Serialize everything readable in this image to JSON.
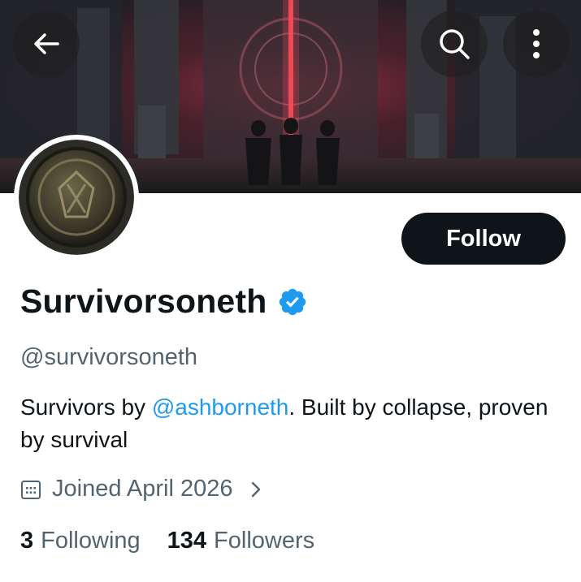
{
  "header": {
    "back_icon": "arrow-left-icon",
    "search_icon": "search-icon",
    "more_icon": "more-vertical-icon"
  },
  "banner": {
    "description_icon": "banner-image"
  },
  "profile": {
    "avatar_icon": "avatar-image",
    "follow_label": "Follow",
    "display_name": "Survivorsoneth",
    "verified_icon": "verified-badge-icon",
    "handle": "@survivorsoneth",
    "bio": {
      "prefix": "Survivors by ",
      "mention": "@ashborneth",
      "suffix": ". Built by collapse, proven by survival"
    },
    "joined": "Joined April 2026",
    "following_count": "3",
    "following_label": "Following",
    "followers_count": "134",
    "followers_label": "Followers"
  },
  "colors": {
    "primary_text": "#0f1419",
    "secondary_text": "#536471",
    "link": "#1d9bf0",
    "verified": "#1d9bf0",
    "button_bg": "#0f1419"
  }
}
